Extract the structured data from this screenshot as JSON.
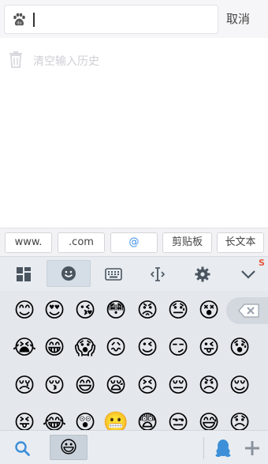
{
  "search": {
    "cancel_label": "取消"
  },
  "history": {
    "label": "清空输入历史"
  },
  "shortcuts": [
    "www.",
    ".com",
    "@",
    "剪贴板",
    "长文本"
  ],
  "toolbar": {
    "icons": [
      "grid-icon",
      "emoji-face-icon",
      "keyboard-icon",
      "text-cursor-icon",
      "gear-icon",
      "chevron-down-icon"
    ]
  },
  "emoji_rows": [
    [
      "😊",
      "😍",
      "😘",
      "😳",
      "😡",
      "😓",
      "😵"
    ],
    [
      "😭",
      "😁",
      "😱",
      "😖",
      "😉",
      "😏",
      "😜",
      "😰"
    ],
    [
      "😢",
      "😚",
      "😄",
      "😪",
      "😣",
      "😔",
      "😠",
      "😌"
    ],
    [
      "😝",
      "😂",
      "😲",
      "😬",
      "😨",
      "😒",
      "😅",
      "😞"
    ]
  ],
  "bottom": {
    "active_emoji": "😃",
    "icons": [
      "search-icon",
      "qq-penguin-icon",
      "plus-icon"
    ]
  }
}
